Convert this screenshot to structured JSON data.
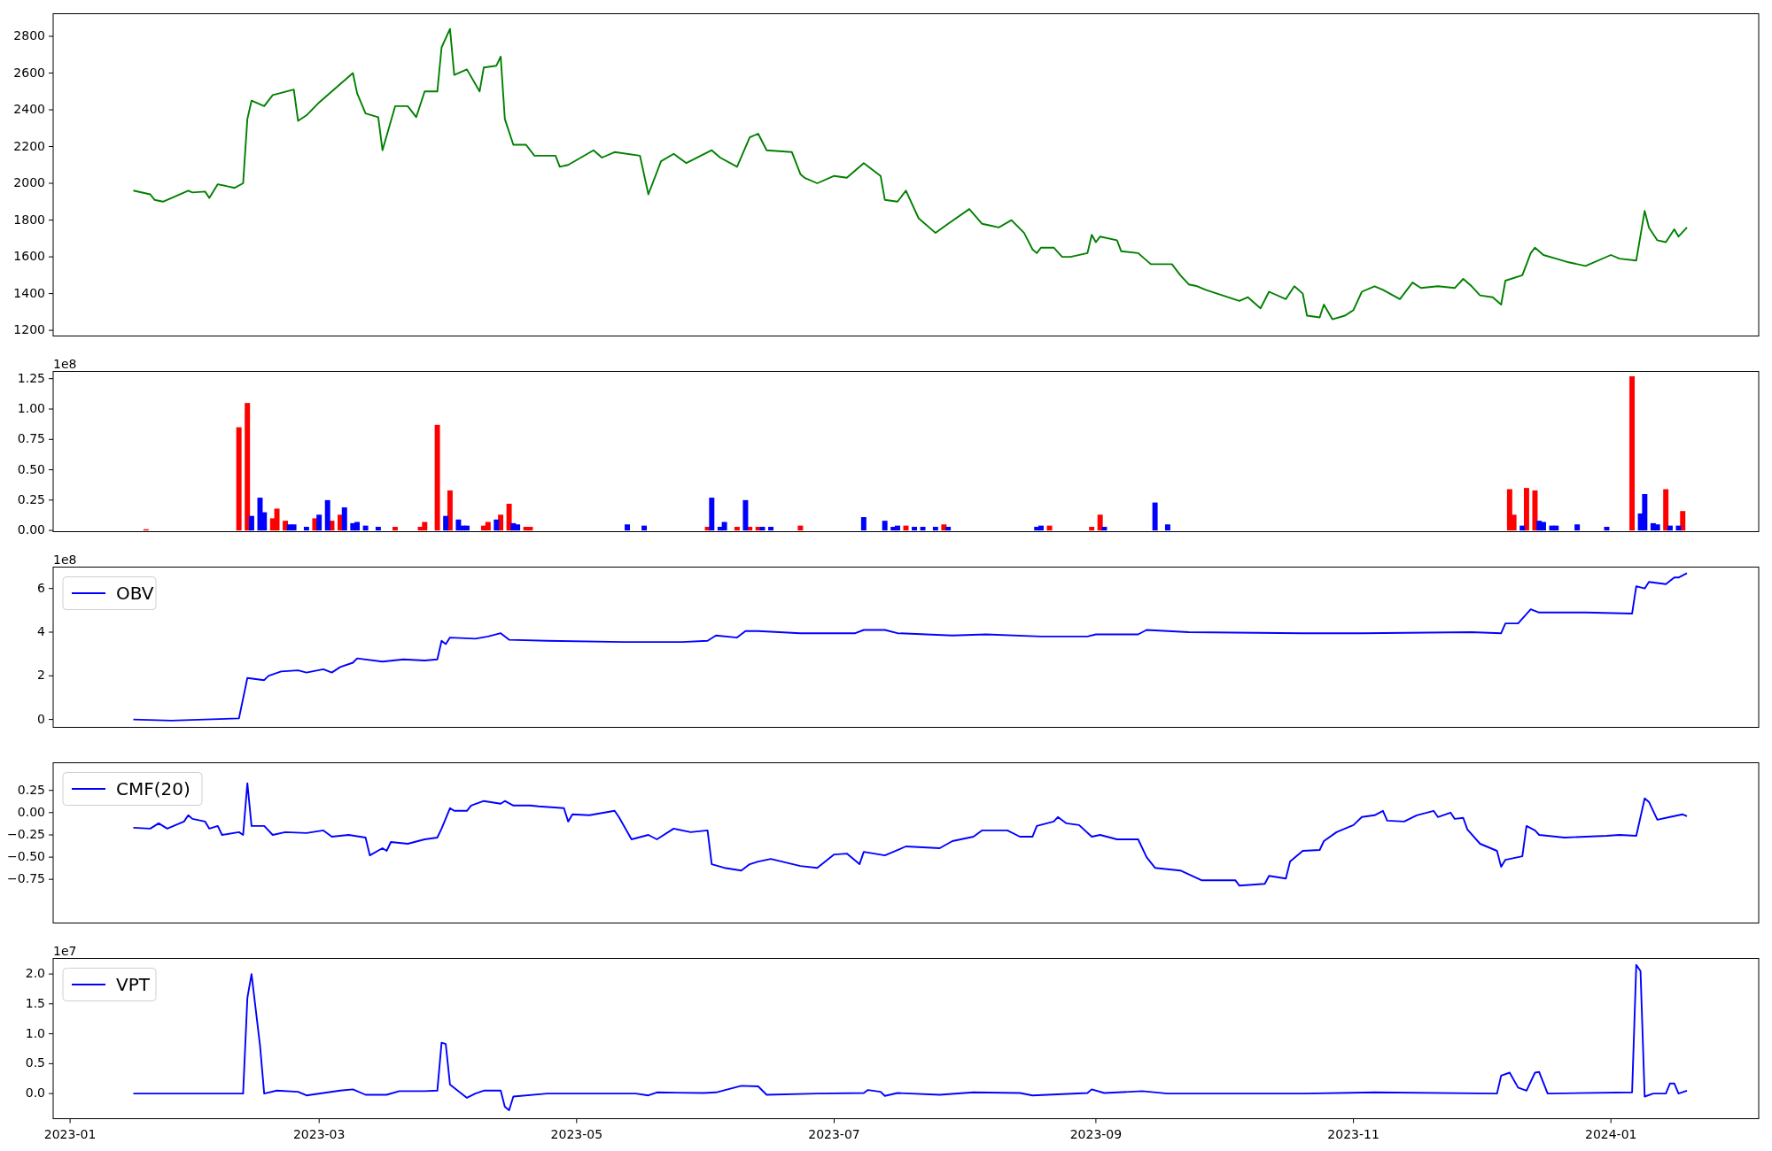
{
  "figure": {
    "panels": [
      {
        "chart_data": {
          "type": "line",
          "xlim": [
            "2022-12-28",
            "2024-02-05"
          ],
          "ylim": [
            1169,
            2923
          ],
          "yticks": [
            1200,
            1400,
            1600,
            1800,
            2000,
            2200,
            2400,
            2600,
            2800
          ],
          "x": [
            "2023-01-16",
            "2023-01-20",
            "2023-01-21",
            "2023-01-23",
            "2023-01-29",
            "2023-01-30",
            "2023-02-02",
            "2023-02-03",
            "2023-02-05",
            "2023-02-09",
            "2023-02-11",
            "2023-02-12",
            "2023-02-13",
            "2023-02-16",
            "2023-02-18",
            "2023-02-23",
            "2023-02-24",
            "2023-02-26",
            "2023-03-01",
            "2023-03-09",
            "2023-03-10",
            "2023-03-12",
            "2023-03-15",
            "2023-03-16",
            "2023-03-19",
            "2023-03-22",
            "2023-03-24",
            "2023-03-26",
            "2023-03-29",
            "2023-03-30",
            "2023-04-01",
            "2023-04-02",
            "2023-04-05",
            "2023-04-08",
            "2023-04-09",
            "2023-04-12",
            "2023-04-13",
            "2023-04-14",
            "2023-04-16",
            "2023-04-19",
            "2023-04-21",
            "2023-04-26",
            "2023-04-27",
            "2023-04-29",
            "2023-05-05",
            "2023-05-07",
            "2023-05-10",
            "2023-05-16",
            "2023-05-18",
            "2023-05-21",
            "2023-05-24",
            "2023-05-27",
            "2023-06-02",
            "2023-06-04",
            "2023-06-08",
            "2023-06-11",
            "2023-06-13",
            "2023-06-15",
            "2023-06-21",
            "2023-06-23",
            "2023-06-24",
            "2023-06-27",
            "2023-07-01",
            "2023-07-04",
            "2023-07-08",
            "2023-07-12",
            "2023-07-13",
            "2023-07-16",
            "2023-07-18",
            "2023-07-21",
            "2023-07-25",
            "2023-07-28",
            "2023-08-02",
            "2023-08-05",
            "2023-08-07",
            "2023-08-09",
            "2023-08-12",
            "2023-08-15",
            "2023-08-17",
            "2023-08-18",
            "2023-08-19",
            "2023-08-22",
            "2023-08-24",
            "2023-08-26",
            "2023-08-30",
            "2023-08-31",
            "2023-09-01",
            "2023-09-02",
            "2023-09-06",
            "2023-09-07",
            "2023-09-11",
            "2023-09-14",
            "2023-09-19",
            "2023-09-21",
            "2023-09-23",
            "2023-09-25",
            "2023-09-27",
            "2023-10-05",
            "2023-10-07",
            "2023-10-10",
            "2023-10-12",
            "2023-10-16",
            "2023-10-18",
            "2023-10-20",
            "2023-10-21",
            "2023-10-24",
            "2023-10-25",
            "2023-10-27",
            "2023-10-30",
            "2023-11-01",
            "2023-11-03",
            "2023-11-06",
            "2023-11-08",
            "2023-11-12",
            "2023-11-15",
            "2023-11-17",
            "2023-11-21",
            "2023-11-25",
            "2023-11-27",
            "2023-11-29",
            "2023-12-01",
            "2023-12-04",
            "2023-12-06",
            "2023-12-07",
            "2023-12-11",
            "2023-12-13",
            "2023-12-14",
            "2023-12-16",
            "2023-12-19",
            "2023-12-22",
            "2023-12-26",
            "2024-01-01",
            "2024-01-03",
            "2024-01-07",
            "2024-01-09",
            "2024-01-10",
            "2024-01-12",
            "2024-01-14",
            "2024-01-16",
            "2024-01-17",
            "2024-01-19"
          ],
          "series": [
            {
              "color": "#008000",
              "values": [
                1960,
                1940,
                1910,
                1900,
                1960,
                1950,
                1955,
                1920,
                1995,
                1975,
                2000,
                2350,
                2450,
                2420,
                2480,
                2510,
                2340,
                2370,
                2440,
                2600,
                2490,
                2380,
                2360,
                2180,
                2420,
                2420,
                2360,
                2500,
                2500,
                2740,
                2840,
                2590,
                2620,
                2500,
                2630,
                2640,
                2690,
                2350,
                2210,
                2210,
                2150,
                2150,
                2090,
                2100,
                2180,
                2140,
                2170,
                2150,
                1940,
                2120,
                2160,
                2110,
                2180,
                2140,
                2090,
                2250,
                2270,
                2180,
                2170,
                2050,
                2030,
                2000,
                2040,
                2030,
                2110,
                2040,
                1910,
                1900,
                1960,
                1810,
                1730,
                1780,
                1860,
                1780,
                1770,
                1760,
                1800,
                1730,
                1640,
                1620,
                1650,
                1650,
                1600,
                1600,
                1620,
                1720,
                1680,
                1710,
                1690,
                1630,
                1620,
                1560,
                1560,
                1500,
                1450,
                1440,
                1420,
                1360,
                1380,
                1320,
                1410,
                1370,
                1440,
                1400,
                1280,
                1270,
                1340,
                1260,
                1280,
                1310,
                1410,
                1440,
                1420,
                1370,
                1460,
                1430,
                1440,
                1430,
                1480,
                1440,
                1390,
                1380,
                1340,
                1470,
                1500,
                1620,
                1650,
                1610,
                1590,
                1570,
                1550,
                1610,
                1590,
                1580,
                1850,
                1760,
                1690,
                1680,
                1750,
                1710,
                1760
              ]
            }
          ]
        }
      },
      {
        "offset_text": "1e8",
        "chart_data": {
          "type": "bar",
          "xlim": [
            "2022-12-28",
            "2024-02-05"
          ],
          "ylim": [
            -0.01,
            1.31
          ],
          "yticks": [
            {
              "value": 0,
              "label": "0.00"
            },
            {
              "value": 0.25,
              "label": "0.25"
            },
            {
              "value": 0.5,
              "label": "0.50"
            },
            {
              "value": 0.75,
              "label": "0.75"
            },
            {
              "value": 1,
              "label": "1.00"
            },
            {
              "value": 1.25,
              "label": "1.25"
            }
          ],
          "x": [
            "2023-01-19",
            "2023-02-10",
            "2023-02-12",
            "2023-02-13",
            "2023-02-15",
            "2023-02-16",
            "2023-02-18",
            "2023-02-19",
            "2023-02-21",
            "2023-02-22",
            "2023-02-23",
            "2023-02-26",
            "2023-02-28",
            "2023-03-01",
            "2023-03-03",
            "2023-03-04",
            "2023-03-06",
            "2023-03-07",
            "2023-03-09",
            "2023-03-10",
            "2023-03-12",
            "2023-03-15",
            "2023-03-19",
            "2023-03-25",
            "2023-03-26",
            "2023-03-29",
            "2023-03-31",
            "2023-04-01",
            "2023-04-03",
            "2023-04-04",
            "2023-04-05",
            "2023-04-09",
            "2023-04-10",
            "2023-04-12",
            "2023-04-13",
            "2023-04-15",
            "2023-04-16",
            "2023-04-17",
            "2023-04-19",
            "2023-04-20",
            "2023-05-13",
            "2023-05-17",
            "2023-06-01",
            "2023-06-02",
            "2023-06-04",
            "2023-06-05",
            "2023-06-08",
            "2023-06-10",
            "2023-06-11",
            "2023-06-13",
            "2023-06-14",
            "2023-06-16",
            "2023-06-23",
            "2023-07-08",
            "2023-07-13",
            "2023-07-15",
            "2023-07-16",
            "2023-07-18",
            "2023-07-20",
            "2023-07-22",
            "2023-07-25",
            "2023-07-27",
            "2023-07-28",
            "2023-08-18",
            "2023-08-19",
            "2023-08-21",
            "2023-08-31",
            "2023-09-02",
            "2023-09-03",
            "2023-09-15",
            "2023-09-18",
            "2023-12-08",
            "2023-12-09",
            "2023-12-11",
            "2023-12-12",
            "2023-12-14",
            "2023-12-15",
            "2023-12-16",
            "2023-12-18",
            "2023-12-19",
            "2023-12-24",
            "2023-12-31",
            "2024-01-06",
            "2024-01-08",
            "2024-01-09",
            "2024-01-11",
            "2024-01-12",
            "2024-01-14",
            "2024-01-15",
            "2024-01-17",
            "2024-01-18"
          ],
          "series": [
            {
              "color": "#ff0000",
              "values": [
                0.01,
                0.85,
                1.05,
                null,
                null,
                null,
                0.1,
                0.18,
                0.08,
                null,
                null,
                null,
                0.1,
                null,
                null,
                0.08,
                0.13,
                null,
                null,
                null,
                null,
                null,
                0.03,
                0.03,
                0.07,
                0.87,
                null,
                0.33,
                null,
                null,
                null,
                0.04,
                0.07,
                null,
                0.13,
                0.22,
                null,
                null,
                0.03,
                0.03,
                null,
                null,
                0.03,
                null,
                null,
                null,
                0.03,
                null,
                0.03,
                0.03,
                null,
                null,
                0.04,
                null,
                null,
                null,
                null,
                0.04,
                null,
                null,
                null,
                0.05,
                null,
                null,
                null,
                0.04,
                0.03,
                0.13,
                null,
                null,
                null,
                0.34,
                0.13,
                null,
                0.35,
                0.33,
                null,
                null,
                null,
                null,
                null,
                null,
                1.27,
                null,
                null,
                null,
                null,
                0.34,
                null,
                null,
                0.16
              ]
            },
            {
              "color": "#0000ff",
              "values": [
                null,
                null,
                null,
                0.12,
                0.27,
                0.15,
                null,
                null,
                null,
                0.05,
                0.05,
                0.03,
                null,
                0.13,
                0.25,
                null,
                null,
                0.19,
                0.06,
                0.07,
                0.04,
                0.03,
                null,
                null,
                null,
                null,
                0.12,
                null,
                0.09,
                0.04,
                0.04,
                null,
                null,
                0.09,
                null,
                null,
                0.06,
                0.05,
                null,
                null,
                0.05,
                0.04,
                null,
                0.27,
                0.03,
                0.07,
                null,
                0.25,
                null,
                null,
                0.03,
                0.03,
                null,
                0.11,
                0.08,
                0.03,
                0.04,
                null,
                0.03,
                0.03,
                0.03,
                null,
                0.03,
                0.03,
                0.04,
                null,
                null,
                null,
                0.03,
                0.23,
                0.05,
                null,
                null,
                0.04,
                null,
                null,
                0.08,
                0.07,
                0.04,
                0.04,
                0.05,
                0.03,
                null,
                0.14,
                0.3,
                0.06,
                0.05,
                null,
                0.04,
                0.04,
                null
              ]
            }
          ]
        }
      },
      {
        "offset_text": "1e8",
        "chart_data": {
          "type": "line",
          "xlim": [
            "2022-12-28",
            "2024-02-05"
          ],
          "ylim": [
            -0.36,
            6.98
          ],
          "yticks": [
            0,
            2,
            4,
            6
          ],
          "x": [
            "2023-01-16",
            "2023-01-25",
            "2023-02-02",
            "2023-02-10",
            "2023-02-12",
            "2023-02-16",
            "2023-02-17",
            "2023-02-20",
            "2023-02-24",
            "2023-02-26",
            "2023-03-02",
            "2023-03-04",
            "2023-03-06",
            "2023-03-09",
            "2023-03-10",
            "2023-03-16",
            "2023-03-21",
            "2023-03-26",
            "2023-03-29",
            "2023-03-30",
            "2023-03-31",
            "2023-04-01",
            "2023-04-07",
            "2023-04-10",
            "2023-04-13",
            "2023-04-15",
            "2023-04-24",
            "2023-05-12",
            "2023-05-26",
            "2023-06-01",
            "2023-06-03",
            "2023-06-08",
            "2023-06-10",
            "2023-06-13",
            "2023-06-23",
            "2023-07-06",
            "2023-07-08",
            "2023-07-13",
            "2023-07-16",
            "2023-07-29",
            "2023-08-06",
            "2023-08-19",
            "2023-08-30",
            "2023-09-01",
            "2023-09-11",
            "2023-09-13",
            "2023-09-23",
            "2023-10-20",
            "2023-11-03",
            "2023-11-29",
            "2023-12-06",
            "2023-12-07",
            "2023-12-10",
            "2023-12-13",
            "2023-12-15",
            "2023-12-26",
            "2024-01-06",
            "2024-01-07",
            "2024-01-09",
            "2024-01-10",
            "2024-01-14",
            "2024-01-16",
            "2024-01-17",
            "2024-01-19"
          ],
          "series": [
            {
              "name": "OBV",
              "color": "#0000ff",
              "values": [
                0,
                -0.05,
                0,
                0.05,
                1.9,
                1.8,
                2.0,
                2.2,
                2.25,
                2.15,
                2.3,
                2.15,
                2.4,
                2.6,
                2.8,
                2.65,
                2.75,
                2.7,
                2.75,
                3.6,
                3.45,
                3.75,
                3.7,
                3.8,
                3.95,
                3.65,
                3.6,
                3.55,
                3.55,
                3.6,
                3.85,
                3.75,
                4.05,
                4.05,
                3.95,
                3.95,
                4.1,
                4.1,
                3.95,
                3.85,
                3.9,
                3.8,
                3.8,
                3.9,
                3.9,
                4.1,
                4.0,
                3.95,
                3.95,
                4.0,
                3.95,
                4.4,
                4.4,
                5.05,
                4.9,
                4.9,
                4.85,
                6.1,
                6.0,
                6.3,
                6.2,
                6.5,
                6.5,
                6.7
              ]
            }
          ]
        }
      },
      {
        "chart_data": {
          "type": "line",
          "xlim": [
            "2022-12-28",
            "2024-02-05"
          ],
          "ylim": [
            -1.24,
            0.56
          ],
          "yticks": [
            {
              "value": 0.25,
              "label": "0.25"
            },
            {
              "value": 0,
              "label": "0.00"
            },
            {
              "value": -0.25,
              "label": "−0.25"
            },
            {
              "value": -0.5,
              "label": "−0.50"
            },
            {
              "value": -0.75,
              "label": "−0.75"
            }
          ],
          "x": [
            "2023-01-16",
            "2023-01-20",
            "2023-01-22",
            "2023-01-24",
            "2023-01-28",
            "2023-01-29",
            "2023-01-30",
            "2023-02-02",
            "2023-02-03",
            "2023-02-05",
            "2023-02-06",
            "2023-02-10",
            "2023-02-11",
            "2023-02-12",
            "2023-02-13",
            "2023-02-16",
            "2023-02-18",
            "2023-02-21",
            "2023-02-26",
            "2023-03-02",
            "2023-03-04",
            "2023-03-08",
            "2023-03-12",
            "2023-03-13",
            "2023-03-16",
            "2023-03-17",
            "2023-03-18",
            "2023-03-22",
            "2023-03-26",
            "2023-03-29",
            "2023-03-30",
            "2023-04-01",
            "2023-04-02",
            "2023-04-05",
            "2023-04-06",
            "2023-04-09",
            "2023-04-13",
            "2023-04-14",
            "2023-04-16",
            "2023-04-20",
            "2023-04-22",
            "2023-04-28",
            "2023-04-29",
            "2023-04-30",
            "2023-05-04",
            "2023-05-10",
            "2023-05-11",
            "2023-05-14",
            "2023-05-18",
            "2023-05-20",
            "2023-05-24",
            "2023-05-28",
            "2023-06-01",
            "2023-06-02",
            "2023-06-05",
            "2023-06-09",
            "2023-06-11",
            "2023-06-13",
            "2023-06-16",
            "2023-06-23",
            "2023-06-27",
            "2023-07-01",
            "2023-07-04",
            "2023-07-07",
            "2023-07-08",
            "2023-07-13",
            "2023-07-18",
            "2023-07-26",
            "2023-07-29",
            "2023-08-03",
            "2023-08-05",
            "2023-08-11",
            "2023-08-14",
            "2023-08-17",
            "2023-08-18",
            "2023-08-22",
            "2023-08-23",
            "2023-08-25",
            "2023-08-28",
            "2023-08-31",
            "2023-09-02",
            "2023-09-06",
            "2023-09-11",
            "2023-09-13",
            "2023-09-15",
            "2023-09-21",
            "2023-09-26",
            "2023-10-04",
            "2023-10-05",
            "2023-10-11",
            "2023-10-12",
            "2023-10-16",
            "2023-10-17",
            "2023-10-20",
            "2023-10-24",
            "2023-10-25",
            "2023-10-28",
            "2023-11-01",
            "2023-11-03",
            "2023-11-06",
            "2023-11-08",
            "2023-11-09",
            "2023-11-13",
            "2023-11-16",
            "2023-11-20",
            "2023-11-21",
            "2023-11-24",
            "2023-11-25",
            "2023-11-27",
            "2023-11-28",
            "2023-12-01",
            "2023-12-05",
            "2023-12-06",
            "2023-12-07",
            "2023-12-11",
            "2023-12-12",
            "2023-12-14",
            "2023-12-15",
            "2023-12-21",
            "2023-12-26",
            "2023-12-31",
            "2024-01-03",
            "2024-01-07",
            "2024-01-09",
            "2024-01-10",
            "2024-01-12",
            "2024-01-15",
            "2024-01-18",
            "2024-01-19"
          ],
          "series": [
            {
              "name": "CMF(20)",
              "color": "#0000ff",
              "values": [
                -0.17,
                -0.18,
                -0.12,
                -0.18,
                -0.1,
                -0.03,
                -0.07,
                -0.1,
                -0.18,
                -0.15,
                -0.25,
                -0.22,
                -0.25,
                0.33,
                -0.15,
                -0.15,
                -0.25,
                -0.22,
                -0.23,
                -0.2,
                -0.27,
                -0.25,
                -0.28,
                -0.48,
                -0.4,
                -0.43,
                -0.33,
                -0.35,
                -0.3,
                -0.28,
                -0.18,
                0.05,
                0.02,
                0.02,
                0.08,
                0.13,
                0.1,
                0.13,
                0.08,
                0.08,
                0.07,
                0.05,
                -0.1,
                -0.02,
                -0.03,
                0.02,
                -0.05,
                -0.3,
                -0.25,
                -0.3,
                -0.18,
                -0.22,
                -0.2,
                -0.58,
                -0.62,
                -0.65,
                -0.58,
                -0.55,
                -0.52,
                -0.6,
                -0.62,
                -0.47,
                -0.46,
                -0.58,
                -0.44,
                -0.48,
                -0.38,
                -0.4,
                -0.32,
                -0.27,
                -0.2,
                -0.2,
                -0.27,
                -0.27,
                -0.15,
                -0.1,
                -0.05,
                -0.12,
                -0.14,
                -0.27,
                -0.25,
                -0.3,
                -0.3,
                -0.5,
                -0.62,
                -0.65,
                -0.76,
                -0.76,
                -0.82,
                -0.8,
                -0.71,
                -0.74,
                -0.55,
                -0.43,
                -0.42,
                -0.32,
                -0.22,
                -0.14,
                -0.05,
                -0.03,
                0.02,
                -0.09,
                -0.1,
                -0.03,
                0.02,
                -0.05,
                0.0,
                -0.07,
                -0.06,
                -0.19,
                -0.35,
                -0.43,
                -0.61,
                -0.53,
                -0.49,
                -0.15,
                -0.2,
                -0.25,
                -0.28,
                -0.27,
                -0.26,
                -0.25,
                -0.26,
                0.16,
                0.12,
                -0.08,
                -0.05,
                -0.02,
                -0.04
              ]
            }
          ]
        }
      },
      {
        "offset_text": "1e7",
        "chart_data": {
          "type": "line",
          "xlim": [
            "2022-12-28",
            "2024-02-05"
          ],
          "ylim": [
            -0.42,
            2.26
          ],
          "yticks": [
            {
              "value": 0,
              "label": "0.0"
            },
            {
              "value": 0.5,
              "label": "0.5"
            },
            {
              "value": 1,
              "label": "1.0"
            },
            {
              "value": 1.5,
              "label": "1.5"
            },
            {
              "value": 2,
              "label": "2.0"
            }
          ],
          "xticks": [
            {
              "value": "2023-01-01",
              "label": "2023-01"
            },
            {
              "value": "2023-03-01",
              "label": "2023-03"
            },
            {
              "value": "2023-05-01",
              "label": "2023-05"
            },
            {
              "value": "2023-07-01",
              "label": "2023-07"
            },
            {
              "value": "2023-09-01",
              "label": "2023-09"
            },
            {
              "value": "2023-11-01",
              "label": "2023-11"
            },
            {
              "value": "2024-01-01",
              "label": "2024-01"
            }
          ],
          "x": [
            "2023-01-16",
            "2023-02-10",
            "2023-02-11",
            "2023-02-12",
            "2023-02-13",
            "2023-02-15",
            "2023-02-16",
            "2023-02-19",
            "2023-02-24",
            "2023-02-26",
            "2023-03-06",
            "2023-03-09",
            "2023-03-12",
            "2023-03-17",
            "2023-03-20",
            "2023-03-26",
            "2023-03-29",
            "2023-03-30",
            "2023-03-31",
            "2023-04-01",
            "2023-04-05",
            "2023-04-07",
            "2023-04-09",
            "2023-04-13",
            "2023-04-14",
            "2023-04-15",
            "2023-04-16",
            "2023-04-24",
            "2023-05-05",
            "2023-05-15",
            "2023-05-18",
            "2023-05-20",
            "2023-05-31",
            "2023-06-03",
            "2023-06-09",
            "2023-06-13",
            "2023-06-15",
            "2023-06-27",
            "2023-07-08",
            "2023-07-09",
            "2023-07-12",
            "2023-07-13",
            "2023-07-16",
            "2023-07-26",
            "2023-08-03",
            "2023-08-14",
            "2023-08-17",
            "2023-08-30",
            "2023-08-31",
            "2023-09-03",
            "2023-09-12",
            "2023-09-18",
            "2023-10-20",
            "2023-11-06",
            "2023-12-05",
            "2023-12-06",
            "2023-12-08",
            "2023-12-10",
            "2023-12-12",
            "2023-12-14",
            "2023-12-15",
            "2023-12-17",
            "2024-01-06",
            "2024-01-07",
            "2024-01-08",
            "2024-01-09",
            "2024-01-11",
            "2024-01-14",
            "2024-01-15",
            "2024-01-16",
            "2024-01-17",
            "2024-01-19"
          ],
          "series": [
            {
              "name": "VPT",
              "color": "#0000ff",
              "values": [
                0,
                0,
                0,
                1.6,
                2.0,
                0.8,
                0,
                0.05,
                0.03,
                -0.03,
                0.05,
                0.07,
                -0.02,
                -0.02,
                0.04,
                0.04,
                0.05,
                0.85,
                0.83,
                0.15,
                -0.07,
                0,
                0.05,
                0.05,
                -0.22,
                -0.28,
                -0.05,
                0,
                0,
                0,
                -0.03,
                0.02,
                0.01,
                0.02,
                0.13,
                0.12,
                -0.02,
                0,
                0.01,
                0.06,
                0.03,
                -0.04,
                0.01,
                -0.02,
                0.02,
                0.01,
                -0.03,
                0.01,
                0.07,
                0.01,
                0.04,
                0,
                0,
                0.02,
                0,
                0.3,
                0.35,
                0.1,
                0.05,
                0.35,
                0.36,
                0,
                0.02,
                2.15,
                2.05,
                -0.05,
                0,
                0,
                0.17,
                0.17,
                0,
                0.05
              ]
            }
          ]
        }
      }
    ]
  }
}
